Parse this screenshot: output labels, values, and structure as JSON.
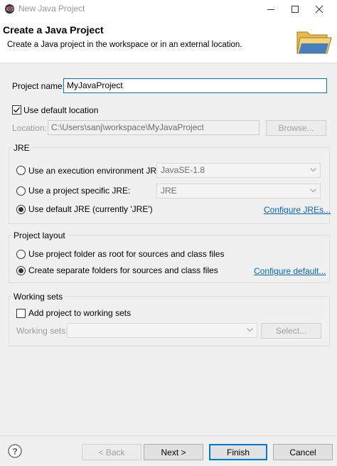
{
  "window": {
    "title": "New Java Project"
  },
  "header": {
    "title": "Create a Java Project",
    "description": "Create a Java project in the workspace or in an external location."
  },
  "project": {
    "name_label": "Project name:",
    "name_value": "MyJavaProject",
    "use_default_location_label": "Use default location",
    "use_default_location_checked": true,
    "location_label": "Location:",
    "location_value": "C:\\Users\\sanj\\workspace\\MyJavaProject",
    "browse_label": "Browse..."
  },
  "jre": {
    "group_title": "JRE",
    "execution_env_label": "Use an execution environment JRE:",
    "execution_env_value": "JavaSE-1.8",
    "project_specific_label": "Use a project specific JRE:",
    "project_specific_value": "JRE",
    "default_jre_label": "Use default JRE (currently 'JRE')",
    "selected": "default_jre",
    "configure_link": "Configure JREs..."
  },
  "layout": {
    "group_title": "Project layout",
    "root_label": "Use project folder as root for sources and class files",
    "separate_label": "Create separate folders for sources and class files",
    "selected": "separate",
    "configure_link": "Configure default..."
  },
  "working_sets": {
    "group_title": "Working sets",
    "add_label": "Add project to working sets",
    "add_checked": false,
    "sets_label": "Working sets:",
    "sets_value": "",
    "select_label": "Select..."
  },
  "footer": {
    "back_label": "< Back",
    "next_label": "Next >",
    "finish_label": "Finish",
    "cancel_label": "Cancel"
  },
  "colors": {
    "link": "#0066cc",
    "focus": "#0078d7",
    "background": "#f0f0f0"
  }
}
